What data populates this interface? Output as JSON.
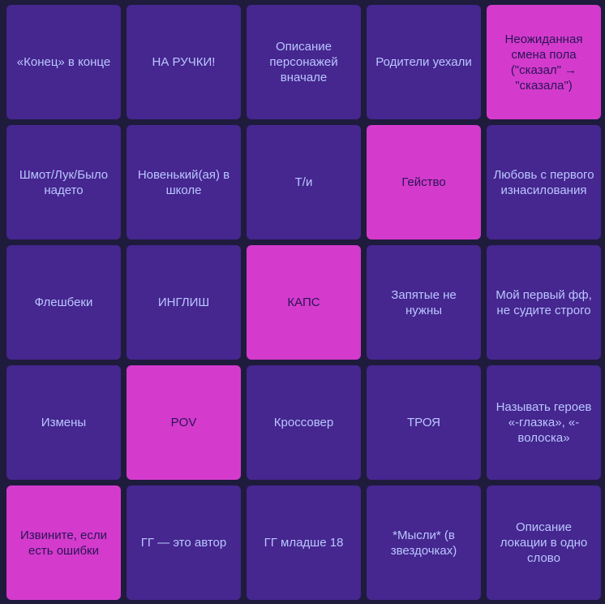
{
  "board": {
    "cells": [
      {
        "text": "«Конец» в конце",
        "marked": false
      },
      {
        "text": "НА РУЧКИ!",
        "marked": false
      },
      {
        "text": "Описание персонажей вначале",
        "marked": false
      },
      {
        "text": "Родители уехали",
        "marked": false
      },
      {
        "text": "Неожиданная смена пола (\"сказал\" → \"сказала\")",
        "marked": true
      },
      {
        "text": "Шмот/Лук/Было надето",
        "marked": false
      },
      {
        "text": "Новенький(ая) в школе",
        "marked": false
      },
      {
        "text": "Т/и",
        "marked": false
      },
      {
        "text": "Гейство",
        "marked": true
      },
      {
        "text": "Любовь с первого изнасилования",
        "marked": false
      },
      {
        "text": "Флешбеки",
        "marked": false
      },
      {
        "text": "ИНГЛИШ",
        "marked": false
      },
      {
        "text": "КАПС",
        "marked": true
      },
      {
        "text": "Запятые не нужны",
        "marked": false
      },
      {
        "text": "Мой первый фф, не судите строго",
        "marked": false
      },
      {
        "text": "Измены",
        "marked": false
      },
      {
        "text": "POV",
        "marked": true
      },
      {
        "text": "Кроссовер",
        "marked": false
      },
      {
        "text": "ТРОЯ",
        "marked": false
      },
      {
        "text": "Называть героев «-глазка», «-волоска»",
        "marked": false
      },
      {
        "text": "Извините, если есть ошибки",
        "marked": true
      },
      {
        "text": "ГГ — это автор",
        "marked": false
      },
      {
        "text": "ГГ младше 18",
        "marked": false
      },
      {
        "text": "*Мысли* (в звездочках)",
        "marked": false
      },
      {
        "text": "Описание локации в одно слово",
        "marked": false
      }
    ]
  },
  "colors": {
    "background": "#1e1b3c",
    "cell": "#46268f",
    "cell_marked": "#d43bcd",
    "text": "#b9c7ff",
    "text_marked": "#2a1456"
  }
}
